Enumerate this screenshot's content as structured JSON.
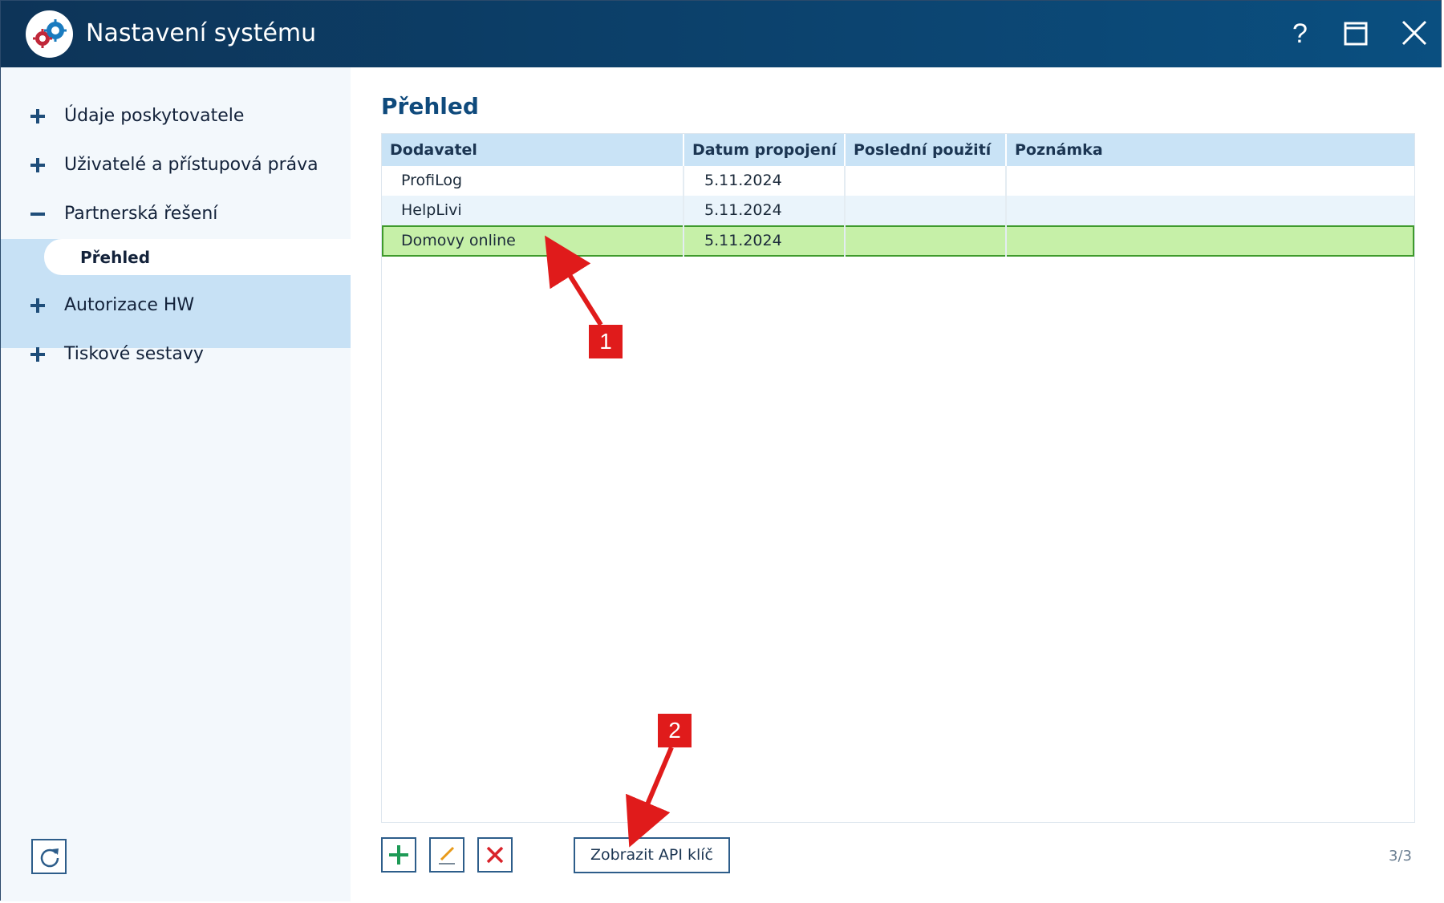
{
  "window": {
    "title": "Nastavení systému",
    "icon": "gears-icon",
    "controls": [
      "help-icon",
      "maximize-icon",
      "close-icon"
    ],
    "help_label": "?"
  },
  "sidebar": {
    "items": [
      {
        "label": "Údaje poskytovatele",
        "icon": "plus-icon",
        "expanded": false
      },
      {
        "label": "Uživatelé a přístupová práva",
        "icon": "plus-icon",
        "expanded": false
      },
      {
        "label": "Partnerská řešení",
        "icon": "minus-icon",
        "expanded": true,
        "children": [
          {
            "label": "Přehled",
            "selected": true
          }
        ]
      },
      {
        "label": "Autorizace HW",
        "icon": "plus-icon",
        "expanded": false
      },
      {
        "label": "Tiskové sestavy",
        "icon": "plus-icon",
        "expanded": false
      }
    ],
    "refresh_icon": "refresh-icon"
  },
  "main": {
    "title": "Přehled",
    "table": {
      "columns": [
        "Dodavatel",
        "Datum propojení",
        "Poslední použití",
        "Poznámka"
      ],
      "rows": [
        {
          "dodavatel": "ProfiLog",
          "datum": "5.11.2024",
          "posledni": "",
          "poznamka": ""
        },
        {
          "dodavatel": "HelpLivi",
          "datum": "5.11.2024",
          "posledni": "",
          "poznamka": ""
        },
        {
          "dodavatel": "Domovy online",
          "datum": "5.11.2024",
          "posledni": "",
          "poznamka": "",
          "selected": true
        }
      ]
    },
    "toolbar": {
      "add_icon": "plus-icon",
      "edit_icon": "pencil-icon",
      "delete_icon": "x-icon",
      "api_button": "Zobrazit API klíč"
    },
    "record_count": "3/3"
  },
  "annotations": [
    {
      "label": "1"
    },
    {
      "label": "2"
    }
  ],
  "colors": {
    "titlebar": "#0c4470",
    "accent": "#0f4a7c",
    "selection": "#c6f0a8",
    "callout": "#e01b1b"
  }
}
